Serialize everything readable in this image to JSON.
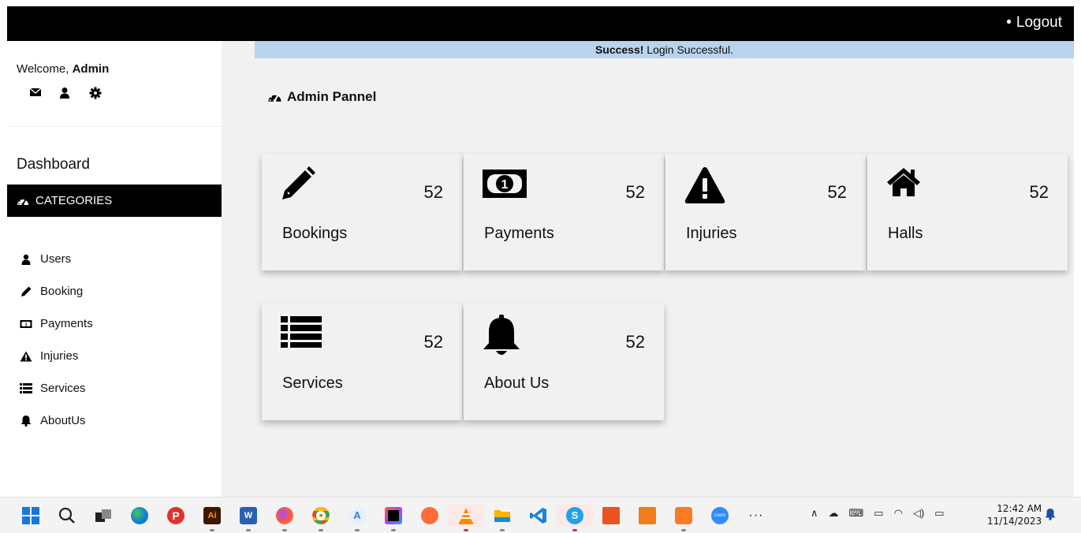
{
  "topbar": {
    "logout_label": "Logout"
  },
  "sidebar": {
    "welcome_prefix": "Welcome, ",
    "welcome_user": "Admin",
    "icons": [
      "envelope-icon",
      "user-icon",
      "gear-icon"
    ],
    "dashboard_label": "Dashboard",
    "categories_label": "CATEGORIES",
    "items": [
      {
        "label": "Users",
        "icon": "user-icon"
      },
      {
        "label": "Booking",
        "icon": "pencil-icon"
      },
      {
        "label": "Payments",
        "icon": "money-icon"
      },
      {
        "label": "Injuries",
        "icon": "warning-icon"
      },
      {
        "label": "Services",
        "icon": "list-icon"
      },
      {
        "label": "AboutUs",
        "icon": "bell-icon"
      }
    ]
  },
  "main": {
    "alert_strong": "Success!",
    "alert_text": " Login Successful.",
    "panel_title": "Admin Pannel",
    "cards": [
      {
        "label": "Bookings",
        "count": "52",
        "icon": "pencil-icon"
      },
      {
        "label": "Payments",
        "count": "52",
        "icon": "money-icon"
      },
      {
        "label": "Injuries",
        "count": "52",
        "icon": "warning-icon"
      },
      {
        "label": "Halls",
        "count": "52",
        "icon": "home-icon"
      },
      {
        "label": "Services",
        "count": "52",
        "icon": "list-icon"
      },
      {
        "label": "About Us",
        "count": "52",
        "icon": "bell-icon"
      }
    ]
  },
  "taskbar": {
    "time": "12:42 AM",
    "date": "11/14/2023",
    "apps": [
      "start-icon",
      "search-icon",
      "task-view-icon",
      "edge-icon",
      "pdf-icon",
      "illustrator-icon",
      "word-icon",
      "firefox-icon",
      "chrome-icon",
      "android-studio-icon",
      "intellij-icon",
      "postman-icon",
      "vlc-icon",
      "file-explorer-icon",
      "vscode-icon",
      "skype-icon",
      "ubuntu-icon",
      "app-icon",
      "xampp-icon",
      "zoom-icon",
      "more-icon"
    ],
    "colors": {
      "edge": "#0f7bd4",
      "pdf": "#e0322d",
      "illustrator": "#3d1500",
      "word": "#2b5fb6",
      "firefox": "#ff8a1f",
      "chrome": "#34a853",
      "vscode": "#1a84d8",
      "skype": "#1ea2ea",
      "ubuntu": "#e95420",
      "xampp": "#fb7a24",
      "zoom": "#2d8cff"
    }
  }
}
